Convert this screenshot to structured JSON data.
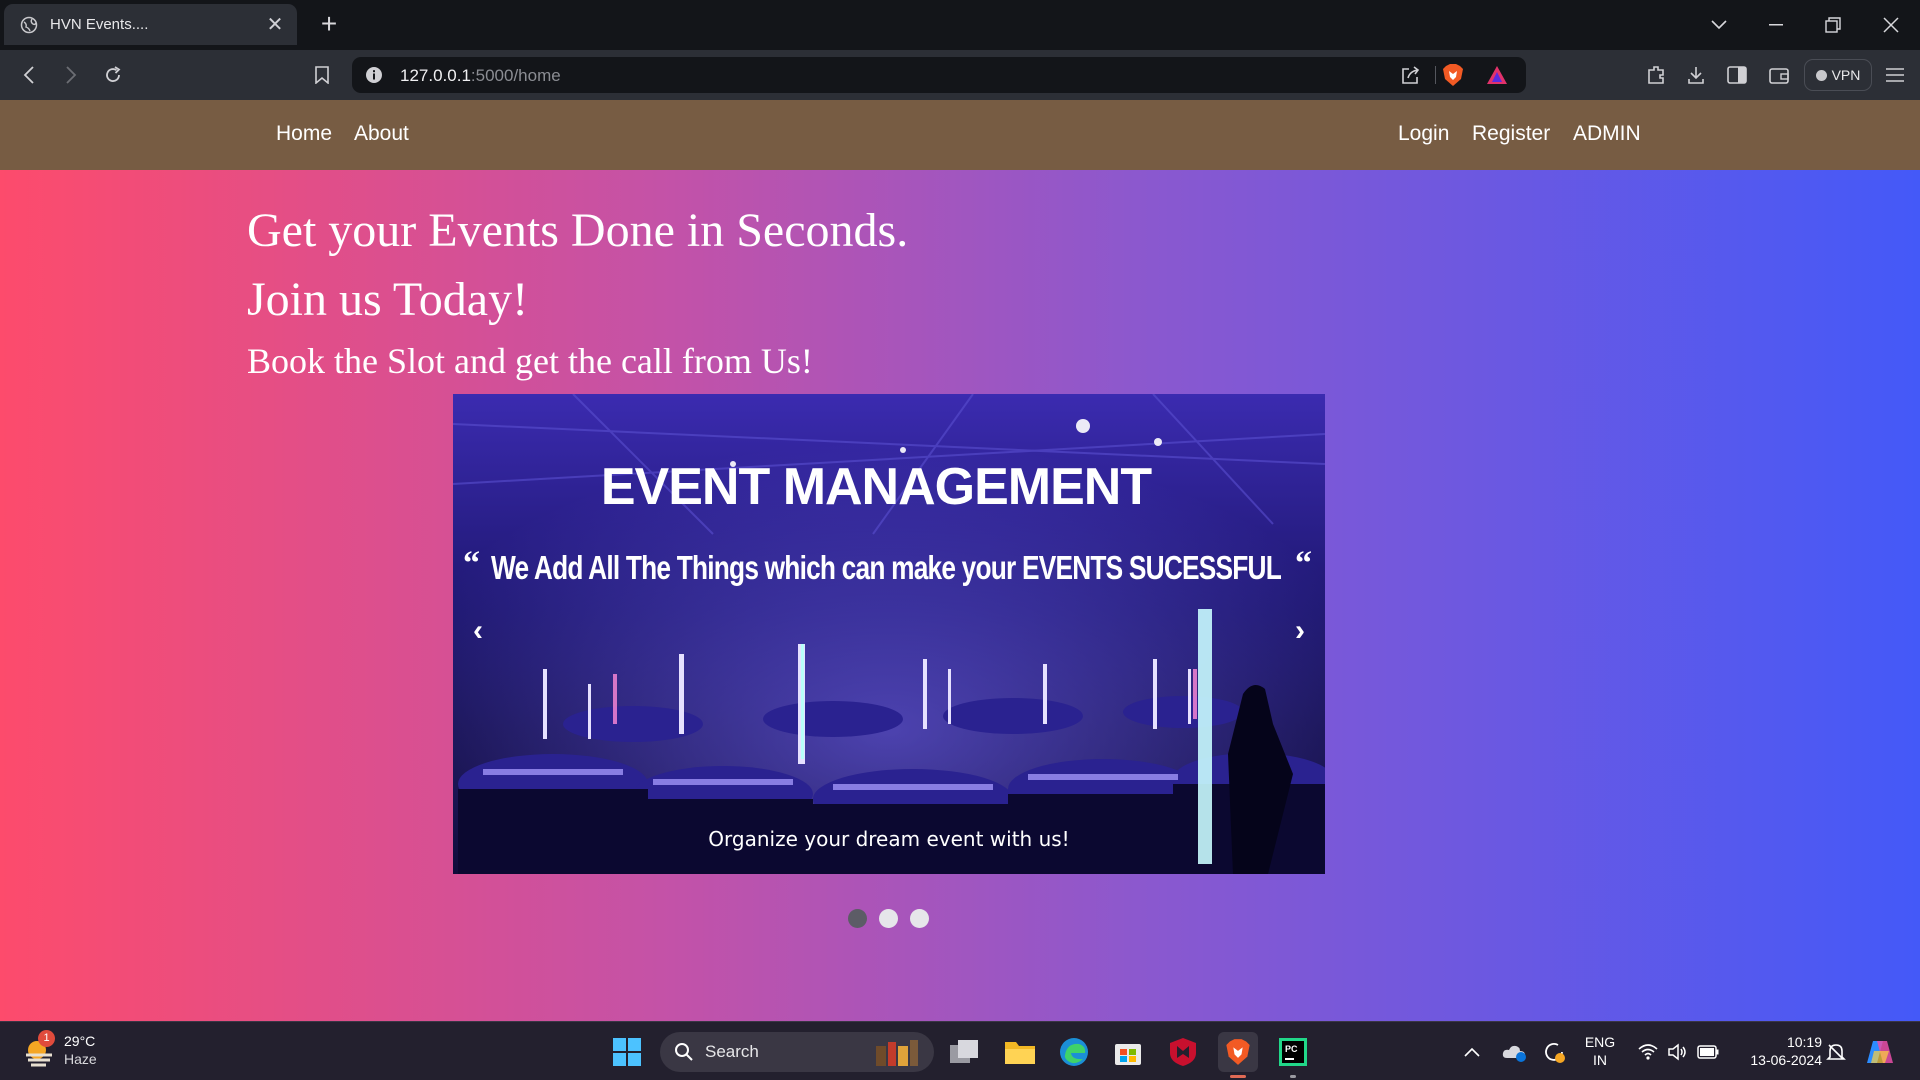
{
  "browser": {
    "tab_title": "HVN Events....",
    "url_host": "127.0.0.1",
    "url_rest": ":5000/home",
    "vpn_label": "VPN"
  },
  "nav": {
    "home": "Home",
    "about": "About",
    "login": "Login",
    "register": "Register",
    "admin": "ADMIN"
  },
  "hero": {
    "line1": "Get your Events Done in Seconds.",
    "line2": "Join us Today!",
    "line3": "Book the Slot and get the call from Us!"
  },
  "carousel": {
    "slide_title": "EVENT MANAGEMENT",
    "slide_quote": "We Add All The Things which can make your EVENTS  SUCESSFUL",
    "caption": "Organize your dream event with us!",
    "prev": "‹",
    "next": "›",
    "active_index": 0,
    "slide_count": 3
  },
  "taskbar": {
    "temperature": "29°C",
    "condition": "Haze",
    "weather_badge": "1",
    "search_label": "Search",
    "lang_top": "ENG",
    "lang_bottom": "IN",
    "time": "10:19",
    "date": "13-06-2024"
  },
  "colors": {
    "navbar": "#775c43",
    "gradient_left": "#fd4b6c",
    "gradient_right": "#4459f8"
  }
}
